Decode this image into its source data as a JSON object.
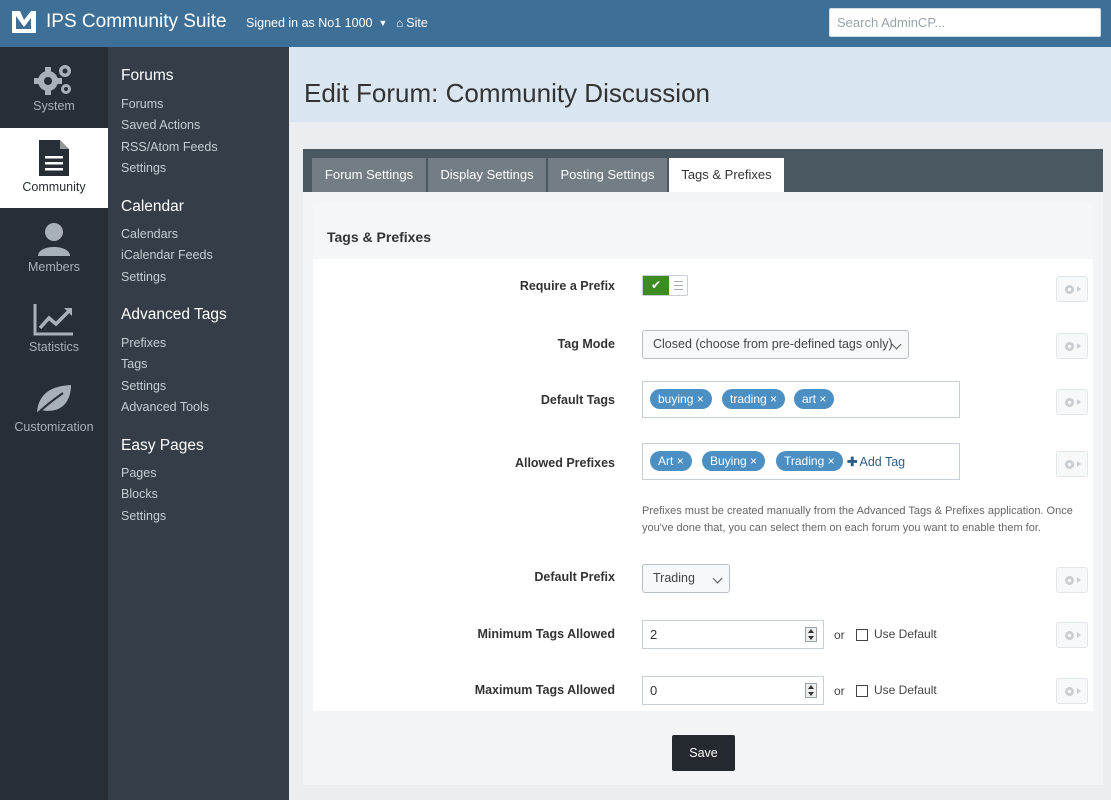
{
  "topbar": {
    "brand": "IPS Community Suite",
    "signed_in": "Signed in as No1 1000",
    "site_link": "Site",
    "search_placeholder": "Search AdminCP..."
  },
  "rail": [
    {
      "label": "System",
      "icon": "gears-icon"
    },
    {
      "label": "Community",
      "icon": "document-icon",
      "active": true
    },
    {
      "label": "Members",
      "icon": "user-icon"
    },
    {
      "label": "Statistics",
      "icon": "chart-icon"
    },
    {
      "label": "Customization",
      "icon": "leaf-icon"
    }
  ],
  "subnav": {
    "forums": {
      "title": "Forums",
      "links": [
        "Forums",
        "Saved Actions",
        "RSS/Atom Feeds",
        "Settings"
      ]
    },
    "calendar": {
      "title": "Calendar",
      "links": [
        "Calendars",
        "iCalendar Feeds",
        "Settings"
      ]
    },
    "advanced_tags": {
      "title": "Advanced Tags",
      "links": [
        "Prefixes",
        "Tags",
        "Settings",
        "Advanced Tools"
      ]
    },
    "easy_pages": {
      "title": "Easy Pages",
      "links": [
        "Pages",
        "Blocks",
        "Settings"
      ]
    }
  },
  "page_title": "Edit Forum: Community Discussion",
  "tabs": [
    "Forum Settings",
    "Display Settings",
    "Posting Settings",
    "Tags & Prefixes"
  ],
  "active_tab": "Tags & Prefixes",
  "form": {
    "section_title": "Tags & Prefixes",
    "require_prefix": {
      "label": "Require a Prefix",
      "value": true
    },
    "tag_mode": {
      "label": "Tag Mode",
      "value": "Closed (choose from pre-defined tags only)"
    },
    "default_tags": {
      "label": "Default Tags",
      "tags": [
        "buying",
        "trading",
        "art"
      ]
    },
    "allowed_prefixes": {
      "label": "Allowed Prefixes",
      "tags": [
        "Art",
        "Buying",
        "Trading"
      ],
      "add_label": "Add Tag",
      "hint": "Prefixes must be created manually from the Advanced Tags & Prefixes application. Once you've done that, you can select them on each forum you want to enable them for."
    },
    "default_prefix": {
      "label": "Default Prefix",
      "value": "Trading"
    },
    "min_tags": {
      "label": "Minimum Tags Allowed",
      "value": "2",
      "or": "or",
      "use_default": "Use Default"
    },
    "max_tags": {
      "label": "Maximum Tags Allowed",
      "value": "0",
      "or": "or",
      "use_default": "Use Default"
    }
  },
  "save_label": "Save",
  "colors": {
    "topbar": "#3e6f96",
    "rail": "#282e35",
    "subnav": "#353e48",
    "tag": "#4c8fc2",
    "toggle_on": "#3c8c22"
  }
}
